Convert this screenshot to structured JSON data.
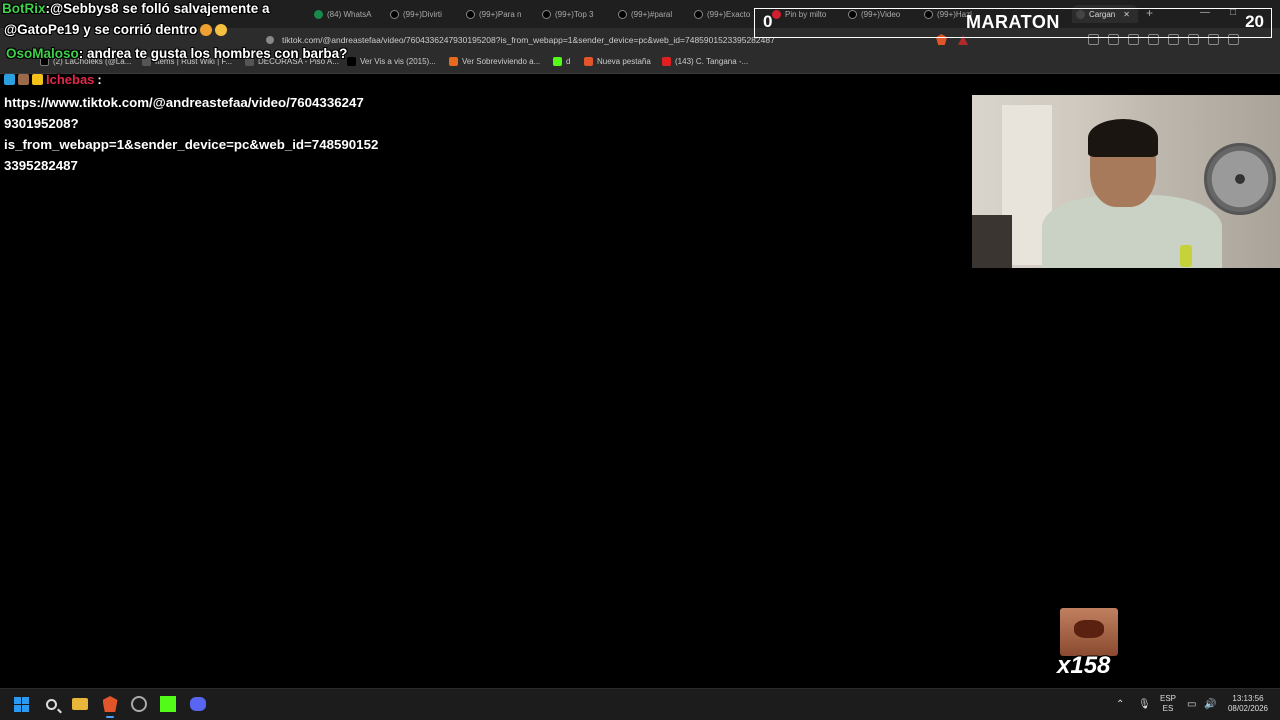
{
  "browser": {
    "tabs": [
      {
        "label": "(84) WhatsA",
        "icon": "whatsapp-icon"
      },
      {
        "label": "(99+)Divirti",
        "icon": "tiktok-icon"
      },
      {
        "label": "(99+)Para n",
        "icon": "tiktok-icon"
      },
      {
        "label": "(99+)Top 3",
        "icon": "tiktok-icon"
      },
      {
        "label": "(99+)#paral",
        "icon": "tiktok-icon"
      },
      {
        "label": "(99+)Exacto",
        "icon": "tiktok-icon"
      },
      {
        "label": "Pin by milto",
        "icon": "pinterest-icon"
      },
      {
        "label": "(99+)Video",
        "icon": "tiktok-icon"
      },
      {
        "label": "(99+)Hazl",
        "icon": "tiktok-icon"
      },
      {
        "label": "Cargan",
        "icon": "loading-icon"
      }
    ],
    "url": "tiktok.com/@andreastefaa/video/7604336247930195208?is_from_webapp=1&sender_device=pc&web_id=7485901523395282487",
    "bookmarks": [
      {
        "label": "(2) LaCholeks (@La...",
        "icon": "x-icon"
      },
      {
        "label": "Items | Rust Wiki | F...",
        "icon": "wiki-icon"
      },
      {
        "label": "DECORASA - Piso A...",
        "icon": "decorasa-icon"
      },
      {
        "label": "Ver Vis a vis (2015)...",
        "icon": "p-icon"
      },
      {
        "label": "Ver Sobreviviendo a...",
        "icon": "orange-icon"
      },
      {
        "label": "d",
        "icon": "kick-icon"
      },
      {
        "label": "Nueva pestaña",
        "icon": "brave-icon"
      },
      {
        "label": "(143) C. Tangana -...",
        "icon": "youtube-icon"
      }
    ]
  },
  "chat": {
    "line1_user": "BotRix",
    "line1_text": ":@Sebbys8 se folló salvajemente a",
    "line2_text": "@GatoPe19 y se corrió dentro",
    "line3_user": "OsoMaloso",
    "line3_text": ": andrea te gusta los hombres con barba?",
    "line4_user": "Ichebas",
    "line4_text": ":",
    "message_lines": [
      "https://www.tiktok.com/@andreastefaa/video/7604336247",
      "930195208?",
      "is_from_webapp=1&sender_device=pc&web_id=748590152",
      "3395282487"
    ]
  },
  "maraton": {
    "left_count": "0",
    "title": "MARATON",
    "right_count": "20"
  },
  "emote": {
    "count": "x158"
  },
  "taskbar": {
    "lang_top": "ESP",
    "lang_bottom": "ES",
    "time": "13:13:56",
    "date": "08/02/2026"
  },
  "colors": {
    "chat_green": "#3fd14a",
    "chat_red": "#e0294a",
    "windows_blue": "#2b9af3",
    "kick_green": "#53fc18"
  }
}
